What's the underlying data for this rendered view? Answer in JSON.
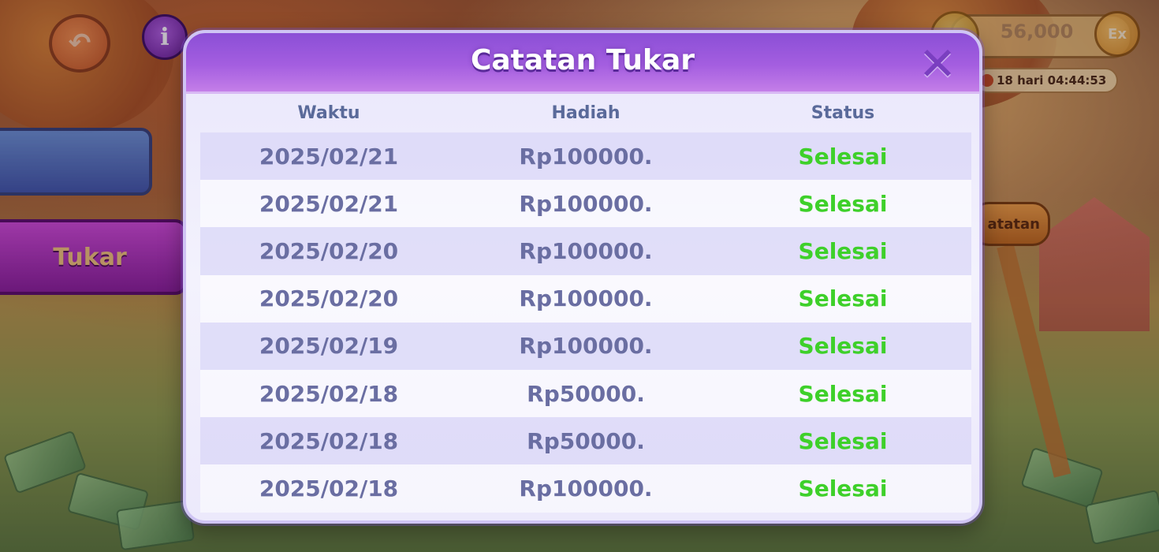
{
  "background": {
    "back_icon": "back-arrow-icon",
    "info_symbol": "i",
    "side_tab_label": "Tukar",
    "coin_balance": "56,000",
    "ex_label": "Ex",
    "timer": "18 hari 04:44:53",
    "catatan_sign": "atatan"
  },
  "modal": {
    "title": "Catatan Tukar",
    "close_symbol": "✕",
    "columns": {
      "time": "Waktu",
      "prize": "Hadiah",
      "status": "Status"
    },
    "rows": [
      {
        "date": "2025/02/21",
        "prize": "Rp100000.",
        "status": "Selesai"
      },
      {
        "date": "2025/02/21",
        "prize": "Rp100000.",
        "status": "Selesai"
      },
      {
        "date": "2025/02/20",
        "prize": "Rp100000.",
        "status": "Selesai"
      },
      {
        "date": "2025/02/20",
        "prize": "Rp100000.",
        "status": "Selesai"
      },
      {
        "date": "2025/02/19",
        "prize": "Rp100000.",
        "status": "Selesai"
      },
      {
        "date": "2025/02/18",
        "prize": "Rp50000.",
        "status": "Selesai"
      },
      {
        "date": "2025/02/18",
        "prize": "Rp50000.",
        "status": "Selesai"
      },
      {
        "date": "2025/02/18",
        "prize": "Rp100000.",
        "status": "Selesai"
      }
    ]
  },
  "colors": {
    "header_purple": "#a45ee0",
    "status_green": "#3ed02a",
    "text_slate": "#6a6ea2"
  }
}
